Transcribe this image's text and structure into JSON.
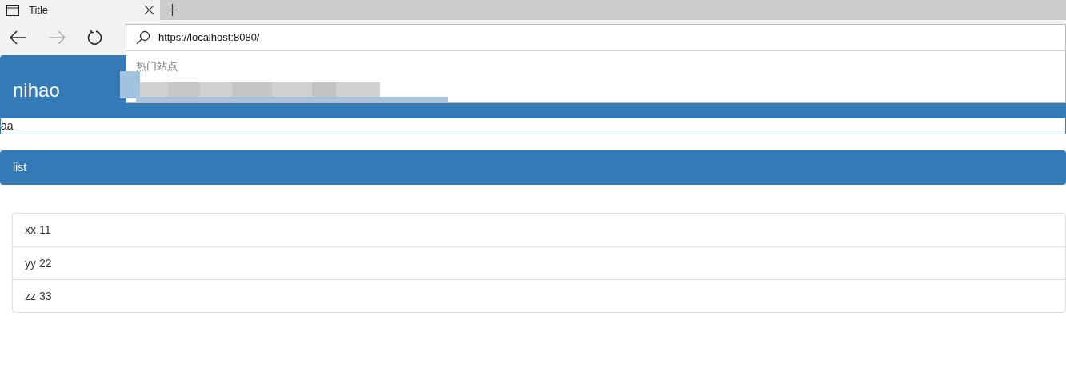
{
  "browser": {
    "tab": {
      "title": "Title"
    },
    "address": {
      "value": "https://localhost:8080/"
    },
    "suggestions": {
      "heading": "热门站点"
    }
  },
  "page": {
    "title": "nihao",
    "input": {
      "value": "aa"
    },
    "panel": {
      "title": "list"
    },
    "items": [
      {
        "name": "xx",
        "value": "11"
      },
      {
        "name": "yy",
        "value": "22"
      },
      {
        "name": "zz",
        "value": "33"
      }
    ]
  }
}
